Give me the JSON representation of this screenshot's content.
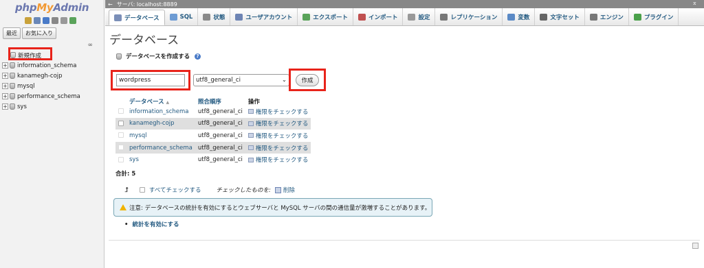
{
  "sidebar": {
    "logo": {
      "php": "php",
      "my": "My",
      "admin": "Admin"
    },
    "tabs": [
      "最近",
      "お気に入り"
    ],
    "new_label": "新規作成",
    "databases": [
      "information_schema",
      "kanamegh-cojp",
      "mysql",
      "performance_schema",
      "sys"
    ]
  },
  "serverbar": {
    "text": "サーバ: localhost:8889",
    "collapse_icon": "←",
    "close_icon": "⌅"
  },
  "tabs": [
    {
      "label": "データベース",
      "icon": "database-icon",
      "color": "#7b8fb8"
    },
    {
      "label": "SQL",
      "icon": "sql-icon",
      "color": "#6d9bd3"
    },
    {
      "label": "状態",
      "icon": "status-icon",
      "color": "#8a8a8a"
    },
    {
      "label": "ユーザアカウント",
      "icon": "users-icon",
      "color": "#6d84b4"
    },
    {
      "label": "エクスポート",
      "icon": "export-icon",
      "color": "#5aa35a"
    },
    {
      "label": "インポート",
      "icon": "import-icon",
      "color": "#c05050"
    },
    {
      "label": "設定",
      "icon": "wrench-icon",
      "color": "#999"
    },
    {
      "label": "レプリケーション",
      "icon": "replication-icon",
      "color": "#777"
    },
    {
      "label": "変数",
      "icon": "variables-icon",
      "color": "#5b8ac6"
    },
    {
      "label": "文字セット",
      "icon": "charset-icon",
      "color": "#666"
    },
    {
      "label": "エンジン",
      "icon": "engine-icon",
      "color": "#777"
    },
    {
      "label": "プラグイン",
      "icon": "plugin-icon",
      "color": "#4aa04a"
    }
  ],
  "main": {
    "title": "データベース",
    "create_label": "データベースを作成する",
    "dbname_value": "wordpress",
    "collation_value": "utf8_general_ci",
    "create_button": "作成",
    "table": {
      "headers": {
        "database": "データベース",
        "sort": "▲",
        "collation": "照合順序",
        "action": "操作"
      },
      "rows": [
        {
          "name": "information_schema",
          "collation": "utf8_general_ci",
          "action": "権限をチェックする"
        },
        {
          "name": "kanamegh-cojp",
          "collation": "utf8_general_ci",
          "action": "権限をチェックする"
        },
        {
          "name": "mysql",
          "collation": "utf8_general_ci",
          "action": "権限をチェックする"
        },
        {
          "name": "performance_schema",
          "collation": "utf8_general_ci",
          "action": "権限をチェックする"
        },
        {
          "name": "sys",
          "collation": "utf8_general_ci",
          "action": "権限をチェックする"
        }
      ]
    },
    "total": "合計: 5",
    "check_all": "すべてチェックする",
    "with_selected": "チェックしたものを:",
    "delete": "削除",
    "notice": "注意: データベースの統計を有効にするとウェブサーバと MySQL サーバの間の通信量が激増することがあります。",
    "stats_link": "統計を有効にする"
  },
  "colors": {
    "highlight": "#e8231a",
    "link": "#235a81"
  }
}
